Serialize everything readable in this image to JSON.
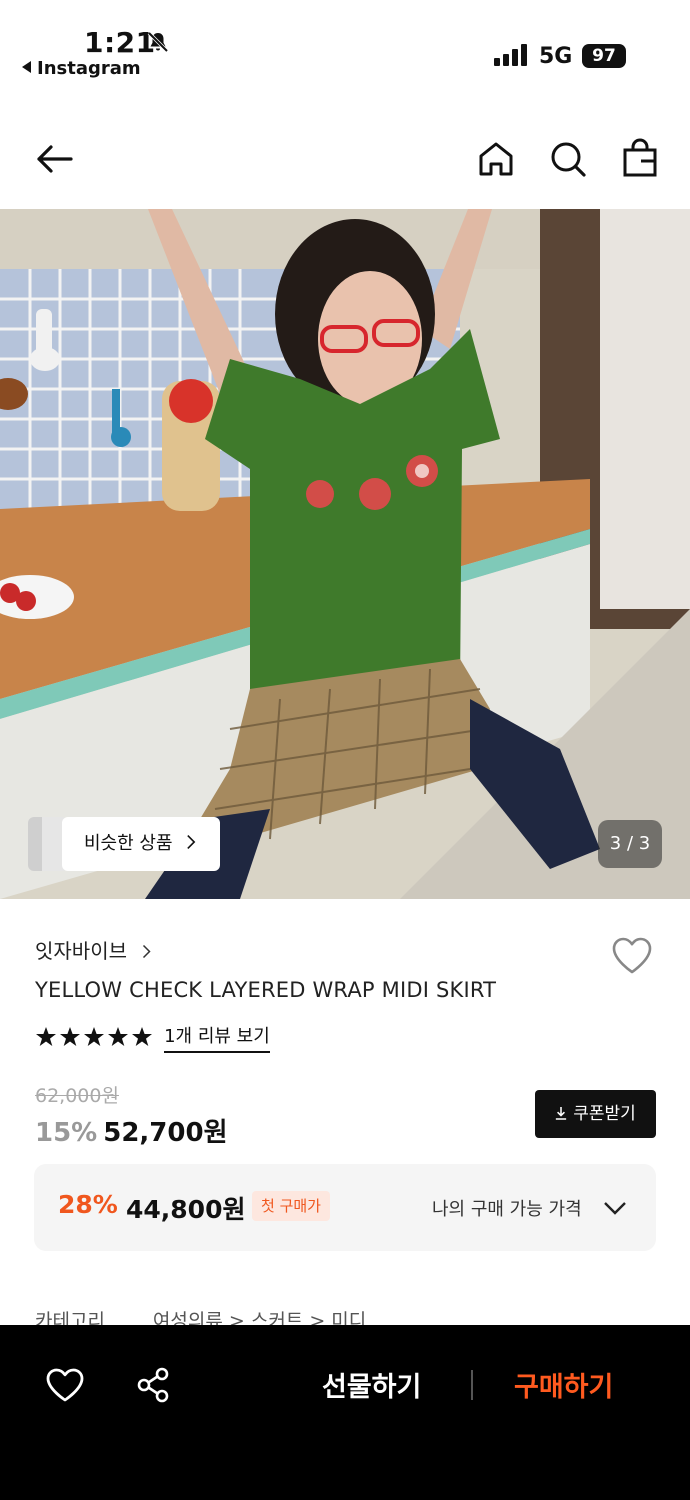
{
  "status": {
    "time": "1:21",
    "back_app": "Instagram",
    "network": "5G",
    "battery": "97"
  },
  "nav": {
    "icons": [
      "arrow-left-icon",
      "home-icon",
      "search-icon",
      "shopping-bag-icon"
    ]
  },
  "gallery": {
    "similar_label": "비슷한 상품",
    "counter": "3 / 3"
  },
  "product": {
    "brand": "잇자바이브",
    "title": "YELLOW CHECK LAYERED WRAP MIDI SKIRT",
    "rating": 5,
    "review_link": "1개 리뷰 보기",
    "original_price": "62,000원",
    "discount_pct": "15%",
    "sale_price": "52,700원",
    "coupon_label": "쿠폰받기"
  },
  "offer": {
    "discount_pct": "28%",
    "price": "44,800원",
    "badge": "첫 구매가",
    "my_price_label": "나의 구매 가능 가격"
  },
  "category": {
    "label": "카테고리",
    "path": "여성의류 > 스커트 > 미디"
  },
  "bottom_bar": {
    "gift_label": "선물하기",
    "buy_label": "구매하기"
  },
  "colors": {
    "accent": "#f0571e",
    "buy": "#ff5a1f",
    "offer_bg": "#f5f5f5"
  }
}
